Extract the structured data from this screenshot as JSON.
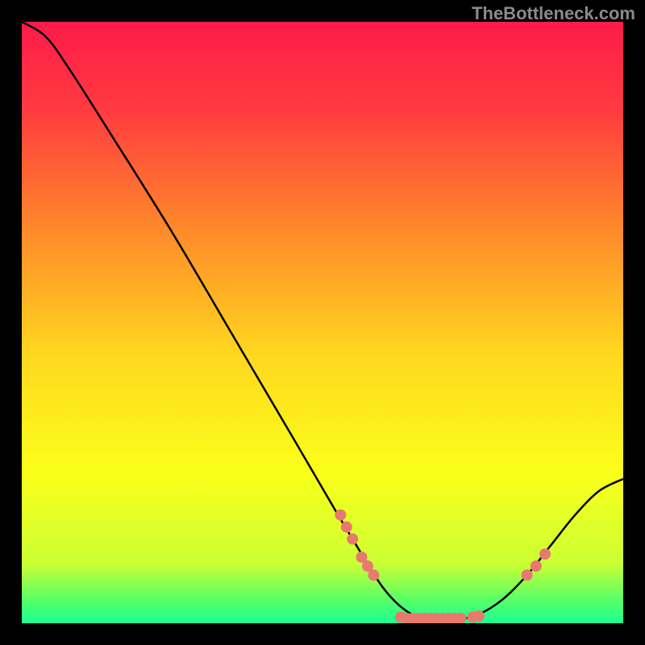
{
  "attribution": "TheBottleneck.com",
  "chart_data": {
    "type": "line",
    "title": "",
    "xlabel": "",
    "ylabel": "",
    "xlim": [
      0,
      100
    ],
    "ylim": [
      0,
      100
    ],
    "curve": [
      {
        "x": 0,
        "y": 100
      },
      {
        "x": 4,
        "y": 97.5
      },
      {
        "x": 8,
        "y": 92
      },
      {
        "x": 15,
        "y": 81
      },
      {
        "x": 25,
        "y": 65
      },
      {
        "x": 35,
        "y": 48
      },
      {
        "x": 45,
        "y": 31
      },
      {
        "x": 52,
        "y": 19
      },
      {
        "x": 55,
        "y": 14
      },
      {
        "x": 60,
        "y": 6
      },
      {
        "x": 64,
        "y": 2
      },
      {
        "x": 68,
        "y": 0.5
      },
      {
        "x": 72,
        "y": 0.5
      },
      {
        "x": 76,
        "y": 1.5
      },
      {
        "x": 80,
        "y": 4
      },
      {
        "x": 84,
        "y": 8
      },
      {
        "x": 88,
        "y": 13
      },
      {
        "x": 92,
        "y": 18
      },
      {
        "x": 96,
        "y": 22
      },
      {
        "x": 100,
        "y": 24
      }
    ],
    "markers": [
      {
        "x": 53,
        "y": 18
      },
      {
        "x": 54,
        "y": 16
      },
      {
        "x": 55,
        "y": 14
      },
      {
        "x": 56.5,
        "y": 11
      },
      {
        "x": 57.5,
        "y": 9.5
      },
      {
        "x": 58.5,
        "y": 8
      },
      {
        "x": 63,
        "y": 1
      },
      {
        "x": 64,
        "y": 0.8
      },
      {
        "x": 65,
        "y": 0.8
      },
      {
        "x": 66,
        "y": 0.8
      },
      {
        "x": 67,
        "y": 0.8
      },
      {
        "x": 68,
        "y": 0.8
      },
      {
        "x": 69,
        "y": 0.8
      },
      {
        "x": 70,
        "y": 0.8
      },
      {
        "x": 71,
        "y": 0.8
      },
      {
        "x": 72,
        "y": 0.8
      },
      {
        "x": 73,
        "y": 0.8
      },
      {
        "x": 75,
        "y": 1
      },
      {
        "x": 76,
        "y": 1.2
      },
      {
        "x": 84,
        "y": 8
      },
      {
        "x": 85.5,
        "y": 9.5
      },
      {
        "x": 87,
        "y": 11.5
      }
    ],
    "background_gradient": {
      "stops": [
        {
          "offset": 0,
          "color": "#ff1a4a"
        },
        {
          "offset": 15,
          "color": "#ff3c3f"
        },
        {
          "offset": 35,
          "color": "#ff8b2a"
        },
        {
          "offset": 55,
          "color": "#ffd61f"
        },
        {
          "offset": 75,
          "color": "#fbff1a"
        },
        {
          "offset": 90,
          "color": "#ccff33"
        },
        {
          "offset": 96,
          "color": "#5bff66"
        },
        {
          "offset": 100,
          "color": "#1aff94"
        }
      ]
    },
    "marker_color": "#e8796f",
    "curve_color": "#000000"
  }
}
